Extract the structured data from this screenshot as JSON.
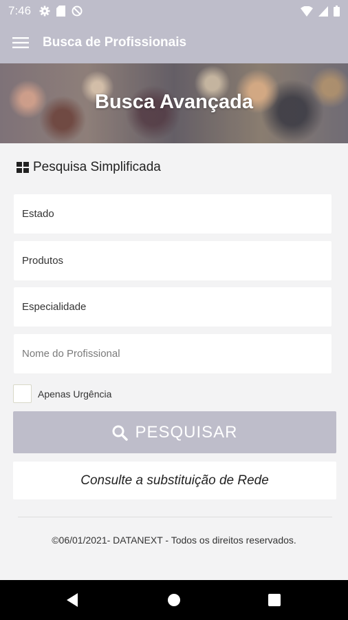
{
  "status_bar": {
    "time": "7:46"
  },
  "app_bar": {
    "title": "Busca de Profissionais"
  },
  "banner": {
    "title": "Busca Avançada"
  },
  "section": {
    "title": "Pesquisa Simplificada"
  },
  "form": {
    "estado": "Estado",
    "produtos": "Produtos",
    "especialidade": "Especialidade",
    "nome_placeholder": "Nome do Profissional",
    "urgencia_label": "Apenas Urgência",
    "urgencia_checked": false
  },
  "buttons": {
    "search_label": "PESQUISAR",
    "network_label": "Consulte a substituição de Rede"
  },
  "footer": {
    "text": "©06/01/2021- DATANEXT - Todos os direitos reservados."
  },
  "colors": {
    "app_bar": "#bebdca",
    "background": "#f3f3f4",
    "nav_bar": "#000000"
  },
  "icons": [
    "settings-icon",
    "sd-card-icon",
    "do-not-disturb-icon",
    "wifi-icon",
    "signal-icon",
    "battery-icon",
    "menu-icon",
    "grid-icon",
    "search-icon",
    "back-icon",
    "home-icon",
    "recents-icon"
  ]
}
